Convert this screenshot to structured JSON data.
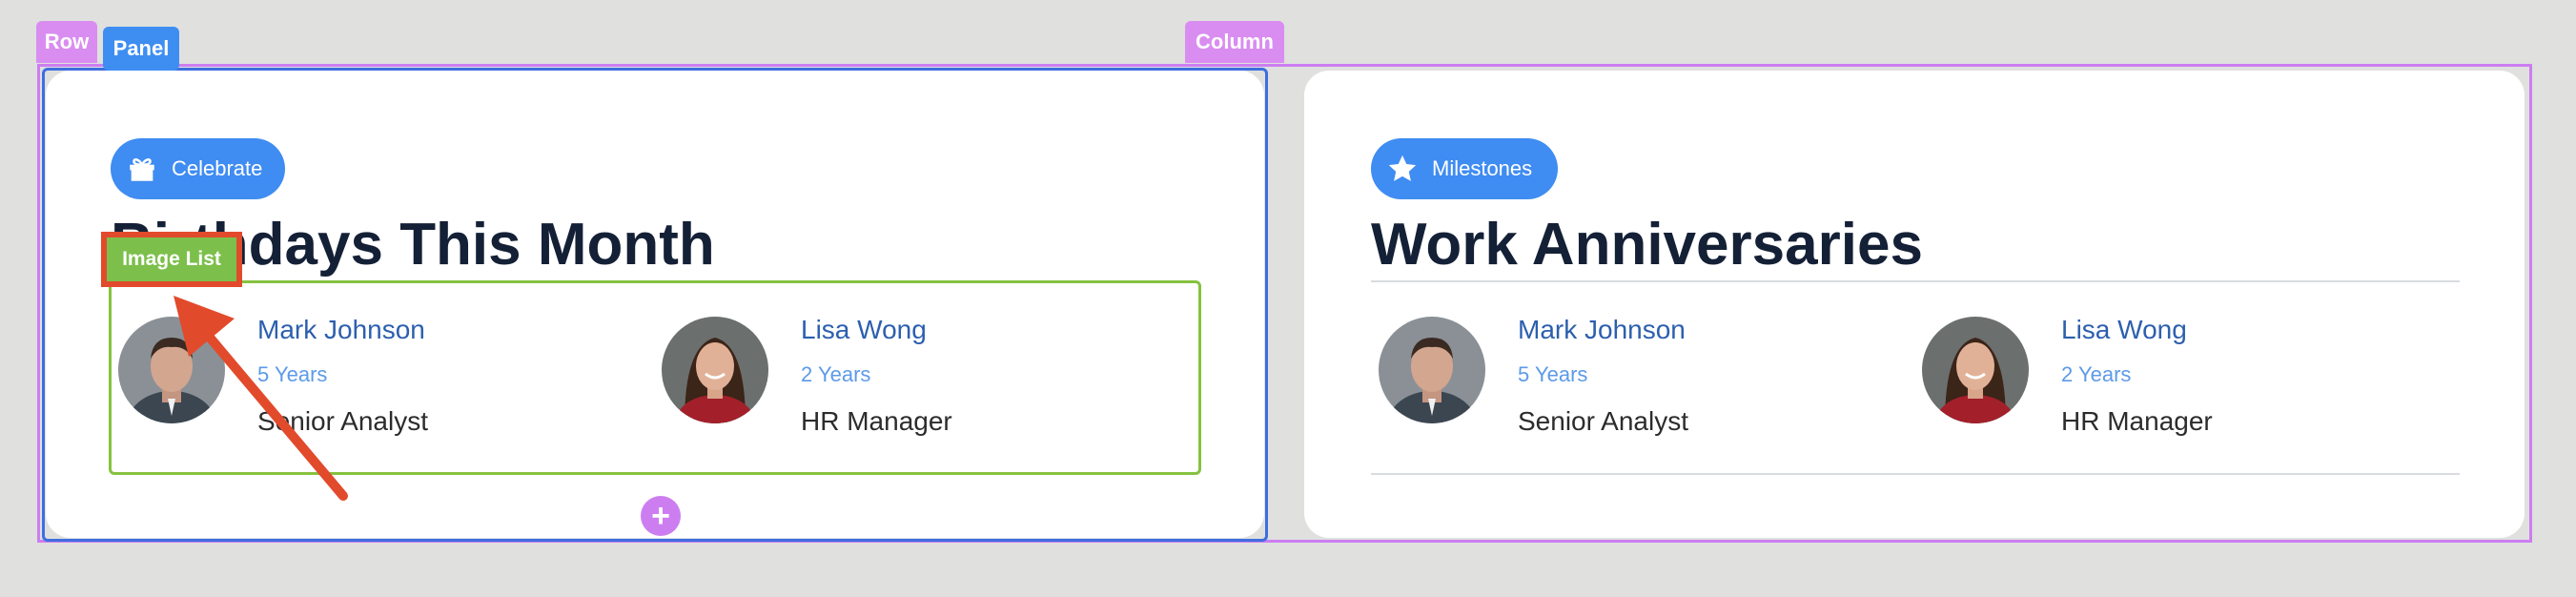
{
  "editor": {
    "row_label": "Row",
    "panel_label": "Panel",
    "column_label": "Column",
    "image_list_label": "Image List",
    "add_symbol": "+"
  },
  "cards": [
    {
      "pill": {
        "label": "Celebrate",
        "icon": "gift-icon"
      },
      "title": "Birthdays This Month",
      "people": [
        {
          "name": "Mark Johnson",
          "years": "5 Years",
          "role": "Senior Analyst"
        },
        {
          "name": "Lisa Wong",
          "years": "2 Years",
          "role": "HR Manager"
        }
      ]
    },
    {
      "pill": {
        "label": "Milestones",
        "icon": "star-icon"
      },
      "title": "Work Anniversaries",
      "people": [
        {
          "name": "Mark Johnson",
          "years": "5 Years",
          "role": "Senior Analyst"
        },
        {
          "name": "Lisa Wong",
          "years": "2 Years",
          "role": "HR Manager"
        }
      ]
    }
  ],
  "colors": {
    "accent": "#3f8cf2",
    "heading": "#142036",
    "row_outline": "#cc7ef0",
    "panel_outline": "#3e6fe0",
    "image_list_outline": "#86c240",
    "annotation": "#e24a2c"
  }
}
